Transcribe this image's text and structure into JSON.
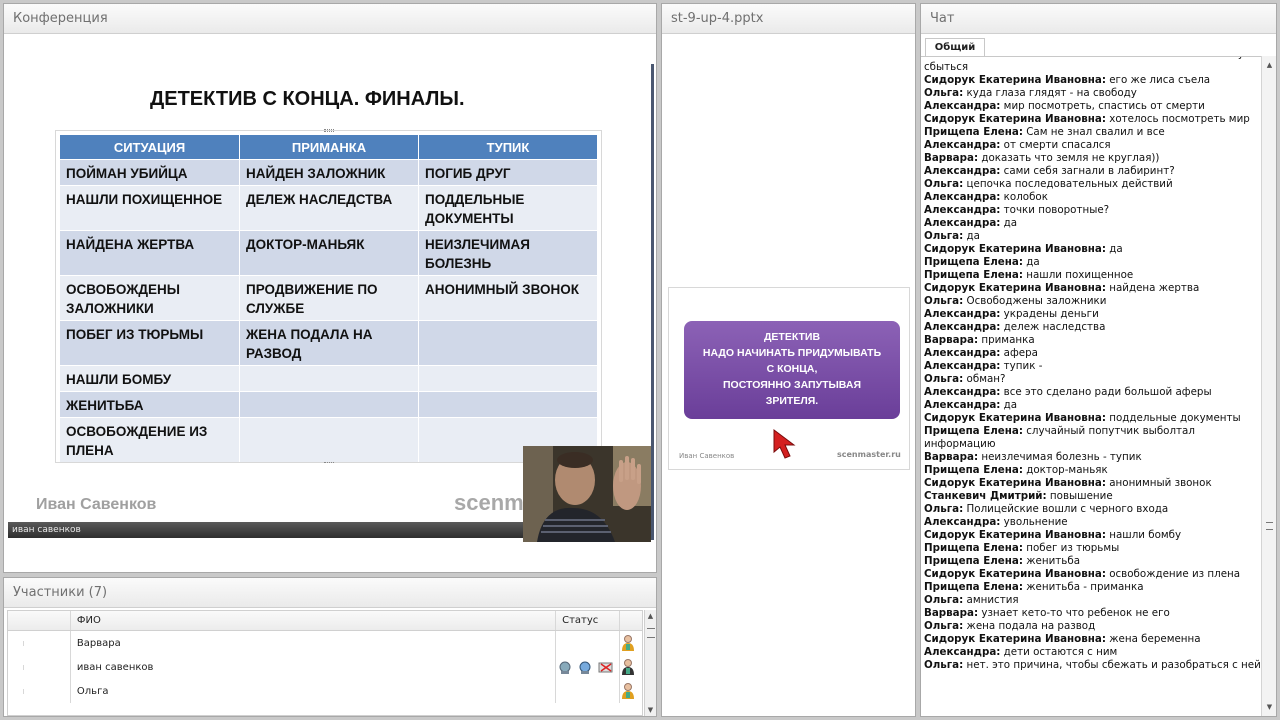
{
  "conference": {
    "title": "Конференция",
    "slide": {
      "heading": "ДЕТЕКТИВ С КОНЦА. ФИНАЛЫ.",
      "columns": [
        "СИТУАЦИЯ",
        "ПРИМАНКА",
        "ТУПИК"
      ],
      "rows": [
        [
          "ПОЙМАН УБИЙЦА",
          "НАЙДЕН  ЗАЛОЖНИК",
          "ПОГИБ ДРУГ"
        ],
        [
          "НАШЛИ ПОХИЩЕННОЕ",
          "ДЕЛЕЖ НАСЛЕДСТВА",
          "ПОДДЕЛЬНЫЕ ДОКУМЕНТЫ"
        ],
        [
          "НАЙДЕНА ЖЕРТВА",
          "ДОКТОР-МАНЬЯК",
          "НЕИЗЛЕЧИМАЯ БОЛЕЗНЬ"
        ],
        [
          "ОСВОБОЖДЕНЫ ЗАЛОЖНИКИ",
          "ПРОДВИЖЕНИЕ ПО СЛУЖБЕ",
          "АНОНИМНЫЙ ЗВОНОК"
        ],
        [
          "ПОБЕГ ИЗ ТЮРЬМЫ",
          "ЖЕНА ПОДАЛА НА РАЗВОД",
          ""
        ],
        [
          "НАШЛИ БОМБУ",
          "",
          ""
        ],
        [
          "ЖЕНИТЬБА",
          "",
          ""
        ],
        [
          "ОСВОБОЖДЕНИЕ ИЗ ПЛЕНА",
          "",
          ""
        ]
      ],
      "author": "Иван Савенков",
      "site_partial": "scenm"
    },
    "speaker_name": "иван савенков"
  },
  "participants": {
    "title": "Участники (7)",
    "columns": [
      "ФИО",
      "Статус"
    ],
    "rows": [
      {
        "name": "Варвара"
      },
      {
        "name": "иван савенков"
      },
      {
        "name": "Ольга"
      }
    ]
  },
  "presentation": {
    "title": "st-9-up-4.pptx",
    "thumb_lines": [
      "ДЕТЕКТИВ",
      "НАДО НАЧИНАТЬ ПРИДУМЫВАТЬ",
      "С КОНЦА,",
      "ПОСТОЯННО ЗАПУТЫВАЯ",
      "ЗРИТЕЛЯ."
    ],
    "thumb_author": "Иван Савенков",
    "thumb_site": "scenmaster.ru"
  },
  "chat": {
    "title": "Чат",
    "tab": "Общий",
    "messages": [
      {
        "author": "Ольга:",
        "text": " может это как - бойтесь своих желаний - они могут сбыться"
      },
      {
        "author": "Сидорук Екатерина Ивановна:",
        "text": " его же лиса съела"
      },
      {
        "author": "Ольга:",
        "text": " куда глаза глядят - на свободу"
      },
      {
        "author": "Александра:",
        "text": " мир посмотреть, спастись от смерти"
      },
      {
        "author": "Сидорук Екатерина Ивановна:",
        "text": " хотелось посмотреть мир"
      },
      {
        "author": "Прищепа Елена:",
        "text": " Сам не знал свалил и все"
      },
      {
        "author": "Александра:",
        "text": " от смерти спасался"
      },
      {
        "author": "Варвара:",
        "text": " доказать что земля не круглая))"
      },
      {
        "author": "Александра:",
        "text": " сами себя загнали в лабиринт?"
      },
      {
        "author": "Ольга:",
        "text": "  цепочка последовательных действий"
      },
      {
        "author": "Александра:",
        "text": " колобок"
      },
      {
        "author": "Александра:",
        "text": " точки поворотные?"
      },
      {
        "author": "Александра:",
        "text": " да"
      },
      {
        "author": "Ольга:",
        "text": " да"
      },
      {
        "author": "Сидорук Екатерина Ивановна:",
        "text": " да"
      },
      {
        "author": "Прищепа Елена:",
        "text": " да"
      },
      {
        "author": "Прищепа Елена:",
        "text": " нашли похищенное"
      },
      {
        "author": "Сидорук Екатерина Ивановна:",
        "text": " найдена жертва"
      },
      {
        "author": "Ольга:",
        "text": " Освободжены заложники"
      },
      {
        "author": "Александра:",
        "text": " украдены деньги"
      },
      {
        "author": "Александра:",
        "text": " дележ наследства"
      },
      {
        "author": "Варвара:",
        "text": " приманка"
      },
      {
        "author": "Александра:",
        "text": " афера"
      },
      {
        "author": "Александра:",
        "text": " тупик -"
      },
      {
        "author": "Ольга:",
        "text": " обман?"
      },
      {
        "author": "Александра:",
        "text": " все это сделано ради большой аферы"
      },
      {
        "author": "Александра:",
        "text": " да"
      },
      {
        "author": "Сидорук Екатерина Ивановна:",
        "text": " поддельные документы"
      },
      {
        "author": "Прищепа Елена:",
        "text": " случайный попутчик выболтал информацию"
      },
      {
        "author": "Варвара:",
        "text": " неизлечимая болезнь - тупик"
      },
      {
        "author": "Прищепа Елена:",
        "text": " доктор-маньяк"
      },
      {
        "author": "Сидорук Екатерина Ивановна:",
        "text": " анонимный звонок"
      },
      {
        "author": "Станкевич Дмитрий:",
        "text": " повышение"
      },
      {
        "author": "Ольга:",
        "text": " Полицейские вошли с черного входа"
      },
      {
        "author": "Александра:",
        "text": " увольнение"
      },
      {
        "author": "Сидорук Екатерина Ивановна:",
        "text": " нашли бомбу"
      },
      {
        "author": "Прищепа Елена:",
        "text": " побег из тюрьмы"
      },
      {
        "author": "Прищепа Елена:",
        "text": " женитьба"
      },
      {
        "author": "Сидорук Екатерина Ивановна:",
        "text": " освобождение из плена"
      },
      {
        "author": "Прищепа Елена:",
        "text": " женитьба - приманка"
      },
      {
        "author": "Ольга:",
        "text": " амнистия"
      },
      {
        "author": "Варвара:",
        "text": " узнает кето-то что ребенок не его"
      },
      {
        "author": "Ольга:",
        "text": " жена подала на развод"
      },
      {
        "author": "Сидорук Екатерина Ивановна:",
        "text": " жена беременна"
      },
      {
        "author": "Александра:",
        "text": " дети остаются с ним"
      },
      {
        "author": "Ольга:",
        "text": " нет. это причина, чтобы сбежать и разобраться с ней"
      }
    ]
  }
}
